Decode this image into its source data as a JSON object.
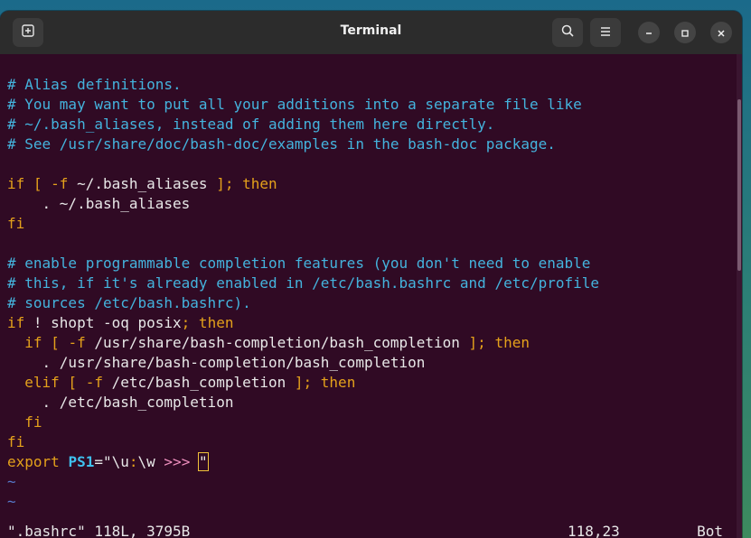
{
  "window": {
    "title": "Terminal"
  },
  "titlebar": {
    "new_tab_icon": "new-tab-icon",
    "search_icon": "search-icon",
    "menu_icon": "hamburger-menu-icon",
    "minimize_icon": "minimize-icon",
    "maximize_icon": "maximize-icon",
    "close_icon": "close-icon"
  },
  "editor": {
    "lines": [
      [
        {
          "t": "# Alias definitions.",
          "c": "comment"
        }
      ],
      [
        {
          "t": "# You may want to put all your additions into a separate file like",
          "c": "comment"
        }
      ],
      [
        {
          "t": "# ~/.bash_aliases, instead of adding them here directly.",
          "c": "comment"
        }
      ],
      [
        {
          "t": "# See /usr/share/doc/bash-doc/examples in the bash-doc package.",
          "c": "comment"
        }
      ],
      [],
      [
        {
          "t": "if",
          "c": "kw"
        },
        {
          "t": " [ ",
          "c": "opt"
        },
        {
          "t": "-f",
          "c": "opt"
        },
        {
          "t": " ~/.bash_aliases ",
          "c": "plain"
        },
        {
          "t": "];",
          "c": "opt"
        },
        {
          "t": " then",
          "c": "kw"
        }
      ],
      [
        {
          "t": "    . ~/.bash_aliases",
          "c": "plain"
        }
      ],
      [
        {
          "t": "fi",
          "c": "kw"
        }
      ],
      [],
      [
        {
          "t": "# enable programmable completion features (you don't need to enable",
          "c": "comment"
        }
      ],
      [
        {
          "t": "# this, if it's already enabled in /etc/bash.bashrc and /etc/profile",
          "c": "comment"
        }
      ],
      [
        {
          "t": "# sources /etc/bash.bashrc).",
          "c": "comment"
        }
      ],
      [
        {
          "t": "if",
          "c": "kw"
        },
        {
          "t": " ! shopt -oq posix",
          "c": "plain"
        },
        {
          "t": ";",
          "c": "opt"
        },
        {
          "t": " then",
          "c": "kw"
        }
      ],
      [
        {
          "t": "  if",
          "c": "kw"
        },
        {
          "t": " [ ",
          "c": "opt"
        },
        {
          "t": "-f",
          "c": "opt"
        },
        {
          "t": " /usr/share/bash-completion/bash_completion ",
          "c": "plain"
        },
        {
          "t": "];",
          "c": "opt"
        },
        {
          "t": " then",
          "c": "kw"
        }
      ],
      [
        {
          "t": "    . /usr/share/bash-completion/bash_completion",
          "c": "plain"
        }
      ],
      [
        {
          "t": "  elif",
          "c": "kw"
        },
        {
          "t": " [ ",
          "c": "opt"
        },
        {
          "t": "-f",
          "c": "opt"
        },
        {
          "t": " /etc/bash_completion ",
          "c": "plain"
        },
        {
          "t": "];",
          "c": "opt"
        },
        {
          "t": " then",
          "c": "kw"
        }
      ],
      [
        {
          "t": "    . /etc/bash_completion",
          "c": "plain"
        }
      ],
      [
        {
          "t": "  fi",
          "c": "kw"
        }
      ],
      [
        {
          "t": "fi",
          "c": "kw"
        }
      ],
      [
        {
          "t": "export ",
          "c": "kw"
        },
        {
          "t": "PS1",
          "c": "bold"
        },
        {
          "t": "=\"",
          "c": "plain"
        },
        {
          "t": "\\u",
          "c": "plain"
        },
        {
          "t": ":",
          "c": "opt"
        },
        {
          "t": "\\w ",
          "c": "plain"
        },
        {
          "t": ">>> ",
          "c": "str"
        },
        {
          "t": "\"",
          "c": "cursor"
        }
      ],
      [
        {
          "t": "~",
          "c": "tilde"
        }
      ],
      [
        {
          "t": "~",
          "c": "tilde"
        }
      ]
    ]
  },
  "status": {
    "file": "\".bashrc\" 118L, 3795B",
    "position": "118,23",
    "scroll": "Bot"
  }
}
